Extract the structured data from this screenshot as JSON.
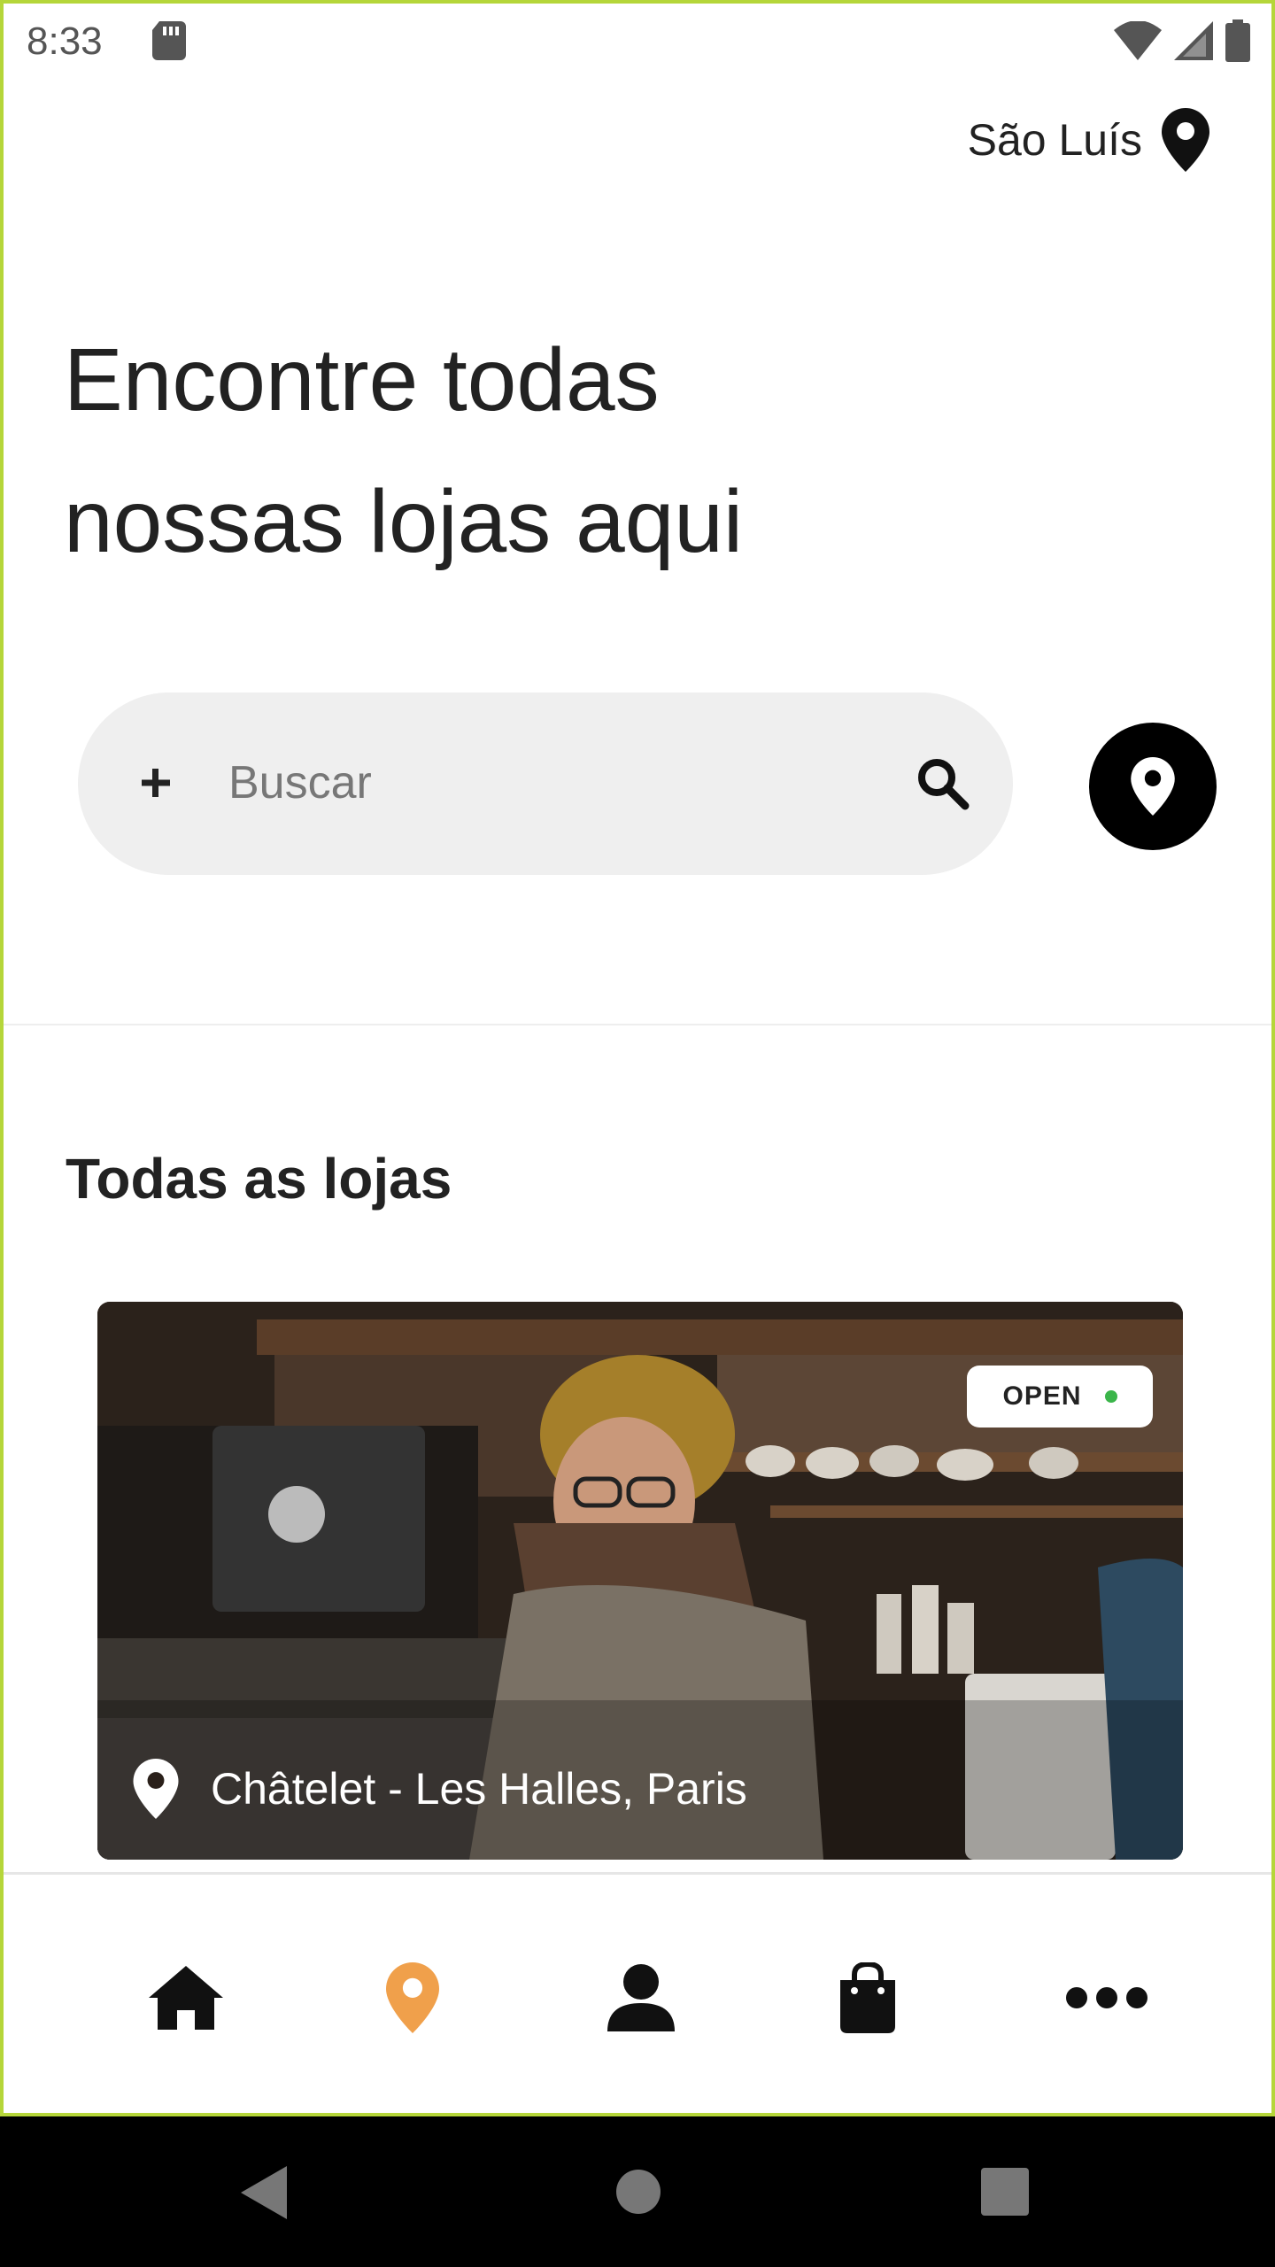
{
  "status_bar": {
    "time": "8:33"
  },
  "header": {
    "city": "São Luís"
  },
  "headline": "Encontre todas nossas lojas aqui",
  "search": {
    "placeholder": "Buscar"
  },
  "section_title": "Todas as lojas",
  "stores": [
    {
      "status": "OPEN",
      "location": "Châtelet - Les Halles, Paris",
      "status_color": "#3bb54a"
    }
  ],
  "bottom_nav": [
    {
      "name": "home",
      "icon": "home-icon",
      "active": false
    },
    {
      "name": "stores",
      "icon": "map-pin-icon",
      "active": true
    },
    {
      "name": "profile",
      "icon": "user-icon",
      "active": false
    },
    {
      "name": "bag",
      "icon": "shopping-bag-icon",
      "active": false
    },
    {
      "name": "more",
      "icon": "more-icon",
      "active": false
    }
  ],
  "colors": {
    "accent": "#f0a04b",
    "frame": "#b5d63a",
    "search_bg": "#efefef"
  }
}
